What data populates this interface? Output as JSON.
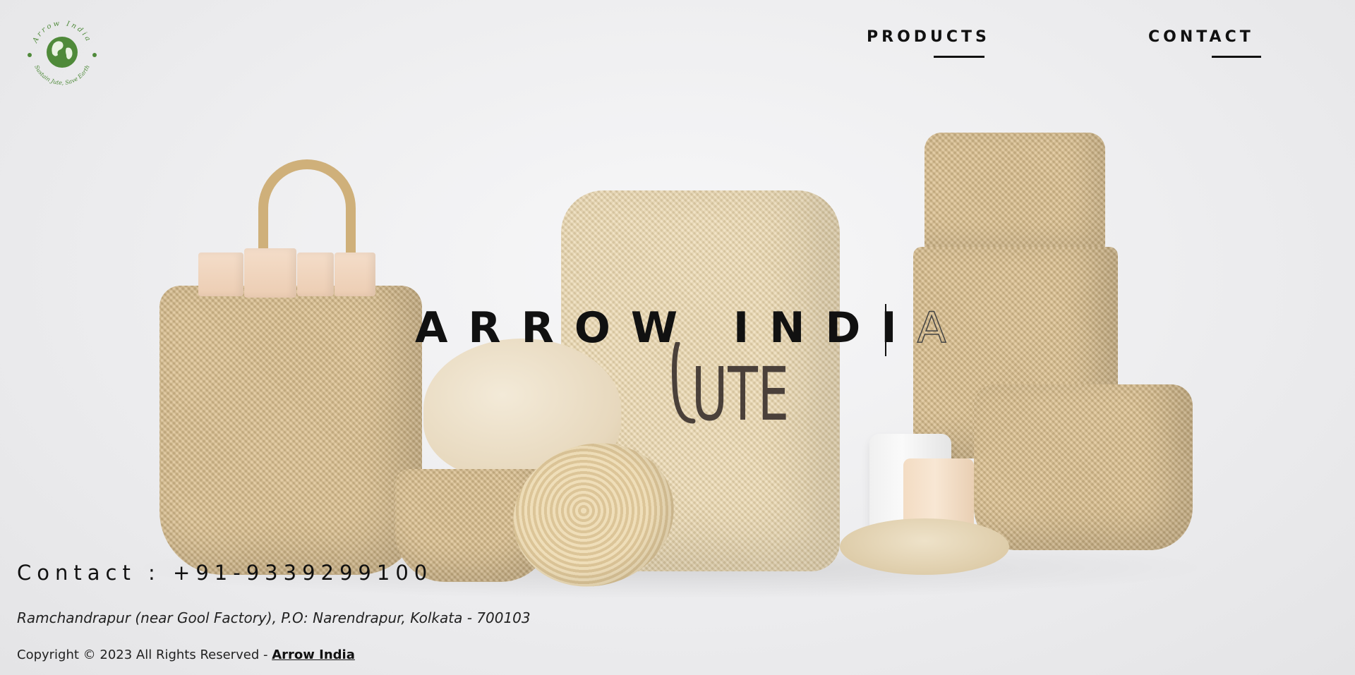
{
  "brand": {
    "logo_text_top": "Arrow India",
    "logo_text_bottom": "Sustain Jute, Save Earth",
    "logo_color": "#4f8a3a"
  },
  "nav": {
    "products_label": "PRODUCTS",
    "contact_label": "CONTACT"
  },
  "hero": {
    "title_main": "ARROW INDI",
    "title_last": "A",
    "subtitle_logo": "JUTE"
  },
  "footer": {
    "contact_label": "Contact",
    "contact_separator": ":",
    "phone": "+91-9339299100",
    "address": "Ramchandrapur (near Gool Factory), P.O: Narendrapur, Kolkata - 700103",
    "copyright_prefix": "Copyright © 2023 All Rights Reserved - ",
    "copyright_link": "Arrow India"
  },
  "colors": {
    "accent": "#111111",
    "background": "#ececee",
    "jute": "#dcc08e"
  }
}
